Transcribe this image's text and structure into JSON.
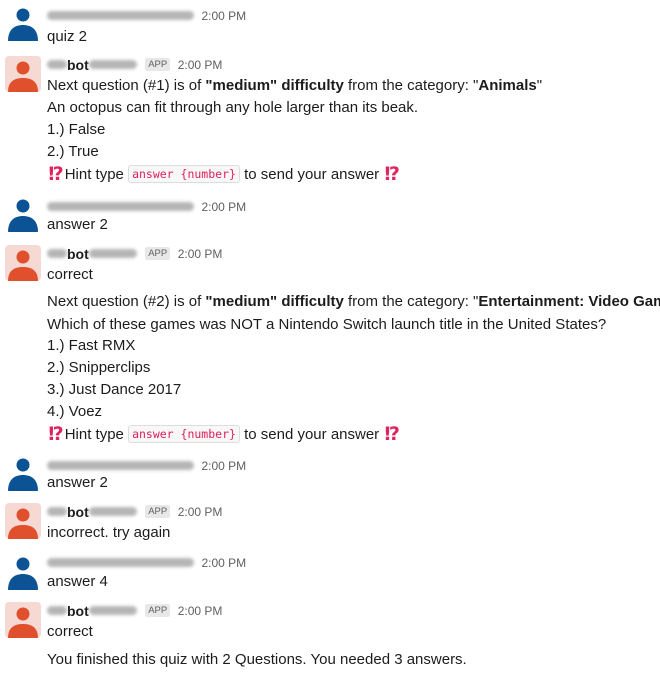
{
  "colors": {
    "user_avatar": "#0b5394",
    "bot_avatar": "#e0502c",
    "code_text": "#e01e5a",
    "hint_emoji": "#e0245e"
  },
  "icons": {
    "user": "person-icon",
    "bot": "person-icon",
    "hint": "exclamation-question-mark-icon"
  },
  "messages": [
    {
      "type": "user",
      "time": "2:00 PM",
      "lines": [
        "quiz 2"
      ]
    },
    {
      "type": "bot",
      "name": "bot",
      "badge": "APP",
      "time": "2:00 PM",
      "q_prefix": "Next question (#1) is of ",
      "difficulty": "\"medium\" difficulty",
      "q_mid": " from the category: \"",
      "category": "Animals",
      "q_suffix": "\"",
      "question": "An octopus can fit through any hole larger than its beak.",
      "options": [
        "1.) False",
        "2.) True"
      ],
      "hint_pre": "Hint type",
      "hint_code": "answer {number}",
      "hint_post": "to send your answer"
    },
    {
      "type": "user",
      "time": "2:00 PM",
      "lines": [
        "answer 2"
      ]
    },
    {
      "type": "bot",
      "name": "bot",
      "badge": "APP",
      "time": "2:00 PM",
      "first": "correct",
      "q_prefix": "Next question (#2) is of ",
      "difficulty": "\"medium\" difficulty",
      "q_mid": " from the category: \"",
      "category": "Entertainment: Video Games",
      "q_suffix": "\"",
      "question": "Which of these games was NOT a Nintendo Switch launch title in the United States?",
      "options": [
        "1.) Fast RMX",
        "2.) Snipperclips",
        "3.) Just Dance 2017",
        "4.) Voez"
      ],
      "hint_pre": "Hint type",
      "hint_code": "answer {number}",
      "hint_post": "to send your answer"
    },
    {
      "type": "user",
      "time": "2:00 PM",
      "lines": [
        "answer 2"
      ]
    },
    {
      "type": "bot",
      "name": "bot",
      "badge": "APP",
      "time": "2:00 PM",
      "lines": [
        "incorrect. try again"
      ]
    },
    {
      "type": "user",
      "time": "2:00 PM",
      "lines": [
        "answer 4"
      ]
    },
    {
      "type": "bot",
      "name": "bot",
      "badge": "APP",
      "time": "2:00 PM",
      "first": "correct",
      "final": "You finished this quiz with 2 Questions. You needed 3 answers."
    }
  ]
}
